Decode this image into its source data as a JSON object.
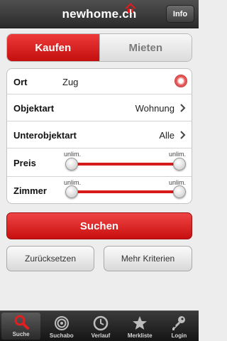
{
  "header": {
    "logo_text": "newhome.ch",
    "info_label": "Info"
  },
  "segment": {
    "buy_label": "Kaufen",
    "rent_label": "Mieten",
    "selected": "Kaufen"
  },
  "form": {
    "ort": {
      "label": "Ort",
      "value": "Zug"
    },
    "objektart": {
      "label": "Objektart",
      "value": "Wohnung"
    },
    "unterobjektart": {
      "label": "Unterobjektart",
      "value": "Alle"
    },
    "preis": {
      "label": "Preis",
      "min_label": "unlim.",
      "max_label": "unlim.",
      "min_level": 0,
      "max_level": 1
    },
    "zimmer": {
      "label": "Zimmer",
      "min_label": "unlim.",
      "max_label": "unlim.",
      "min_level": 0,
      "max_level": 1
    }
  },
  "buttons": {
    "search": "Suchen",
    "reset": "Zurücksetzen",
    "more_criteria": "Mehr Kriterien"
  },
  "tabs": [
    {
      "label": "Suche",
      "icon": "search-icon",
      "active": true
    },
    {
      "label": "Suchabo",
      "icon": "target-icon",
      "active": false
    },
    {
      "label": "Verlauf",
      "icon": "clock-icon",
      "active": false
    },
    {
      "label": "Merkliste",
      "icon": "star-icon",
      "active": false
    },
    {
      "label": "Login",
      "icon": "key-icon",
      "active": false
    }
  ],
  "colors": {
    "accent_red": "#d71a1a",
    "header_dark": "#2b2b2b",
    "background": "#ededed"
  }
}
